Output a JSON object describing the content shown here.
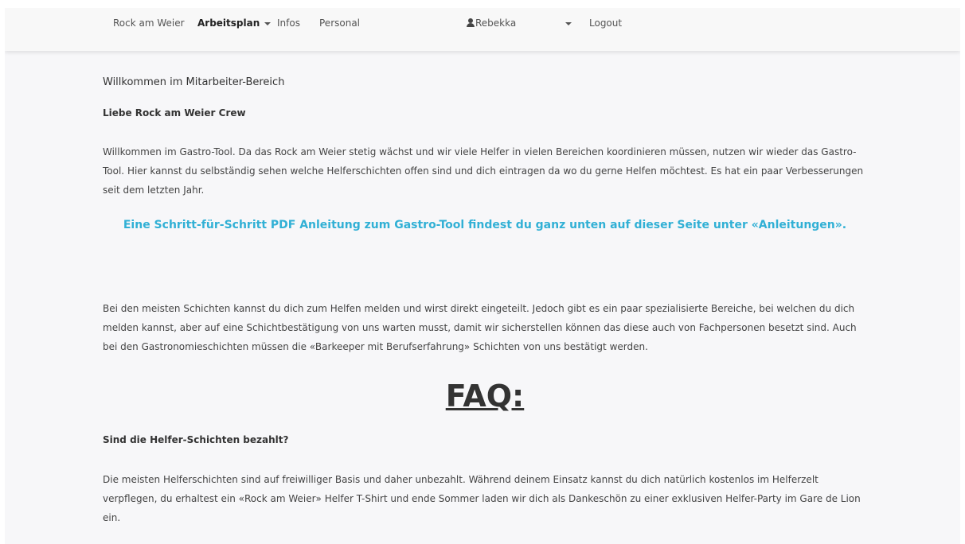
{
  "navbar": {
    "links": [
      {
        "label": "Rock am Weier",
        "active": false
      },
      {
        "label": "Arbeitsplan",
        "active": true,
        "dropdown": true
      },
      {
        "label": "Infos",
        "active": false
      },
      {
        "label": "Personal",
        "active": false
      }
    ],
    "user": {
      "name": "Rebekka",
      "icon": "user-icon"
    },
    "user_dropdown_icon": "caret-down-icon",
    "logout_label": "Logout"
  },
  "main": {
    "welcome_line": "Willkommen im Mitarbeiter-Bereich",
    "greeting_title": "Liebe Rock am Weier Crew",
    "intro_paragraph": "Willkommen im Gastro-Tool. Da das Rock am Weier stetig wächst und wir viele Helfer in vielen Bereichen koordinieren müssen, nutzen wir wieder das Gastro-Tool. Hier kannst du selbständig sehen welche Helferschichten offen sind und dich eintragen da wo du gerne Helfen möchtest. Es hat ein paar Verbesserungen seit dem letzten Jahr.",
    "highlight_note": "Eine Schritt-für-Schritt PDF Anleitung zum Gastro-Tool findest du ganz unten auf dieser Seite unter «Anleitungen».",
    "shifts_paragraph": "Bei den meisten Schichten kannst du dich zum Helfen melden und wirst direkt eingeteilt. Jedoch gibt es ein paar spezialisierte Bereiche, bei welchen du dich melden kannst, aber auf eine Schichtbestätigung von uns warten musst, damit wir sicherstellen können das diese auch von Fachpersonen besetzt sind. Auch bei den Gastronomieschichten müssen die «Barkeeper mit Berufserfahrung» Schichten von uns bestätigt werden.",
    "faq_heading": "FAQ:",
    "faq_items": [
      {
        "question": "Sind die Helfer-Schichten bezahlt?",
        "answer": "Die meisten Helferschichten sind auf freiwilliger Basis und daher unbezahlt. Während deinem Einsatz kannst du dich natürlich kostenlos im Helferzelt verpflegen, du erhaltest ein «Rock am Weier» Helfer T-Shirt und ende Sommer laden wir dich als Dankeschön zu einer exklusiven Helfer-Party im Gare de Lion ein."
      }
    ]
  },
  "colors": {
    "highlight": "#31b0d5",
    "background": "#f7f7f9",
    "navbar": "#f8f8f8"
  }
}
